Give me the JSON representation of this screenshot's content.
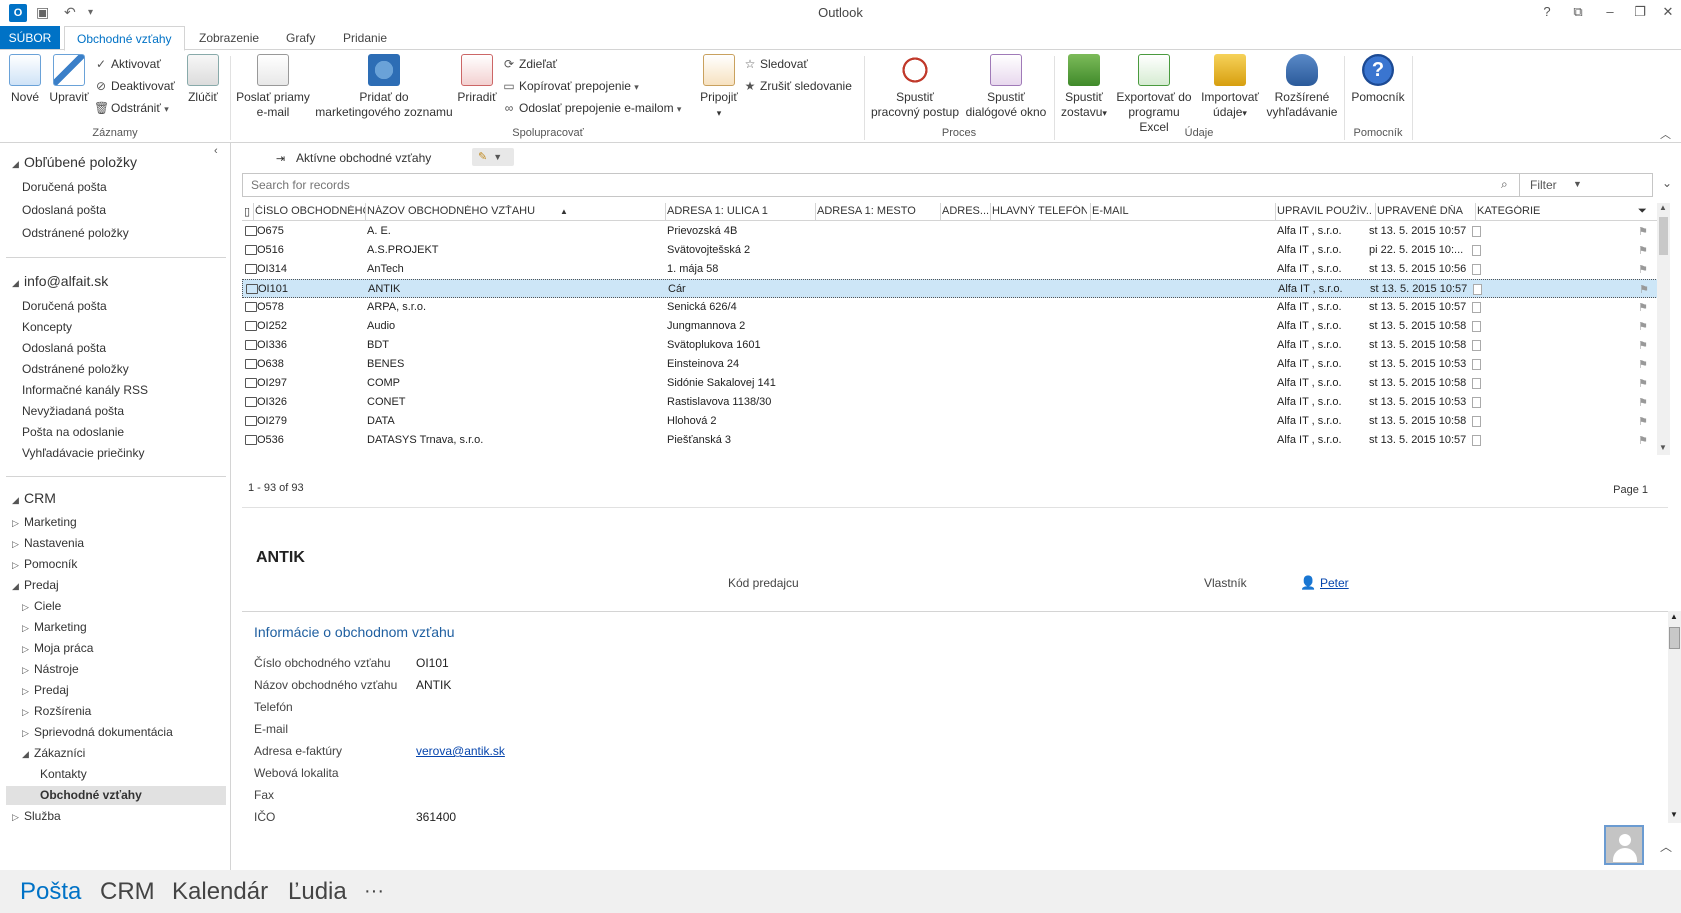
{
  "titlebar": {
    "app_title": "Outlook",
    "app_icon_letter": "O"
  },
  "tabs": [
    "SÚBOR",
    "Obchodné vzťahy",
    "Zobrazenie",
    "Grafy",
    "Pridanie"
  ],
  "ribbon": {
    "records": {
      "new": "Nové",
      "edit": "Upraviť",
      "activate": "Aktivovať",
      "deactivate": "Deaktivovať",
      "delete": "Odstrániť",
      "merge": "Zlúčiť",
      "label": "Záznamy"
    },
    "collaborate": {
      "send_email": "Poslať priamy e-mail",
      "send_email_l1": "Poslať priamy",
      "send_email_l2": "e-mail",
      "add_marketing_l1": "Pridať do",
      "add_marketing_l2": "marketingového zoznamu",
      "assign": "Priradiť",
      "share": "Zdieľať",
      "copy_link": "Kopírovať prepojenie",
      "email_link": "Odoslať prepojenie e-mailom",
      "connect": "Pripojiť",
      "follow": "Sledovať",
      "unfollow": "Zrušiť sledovanie",
      "label": "Spolupracovať"
    },
    "process": {
      "workflow_l1": "Spustiť",
      "workflow_l2": "pracovný postup",
      "dialog_l1": "Spustiť",
      "dialog_l2": "dialógové okno",
      "label": "Proces"
    },
    "data": {
      "report_l1": "Spustiť",
      "report_l2": "zostavu",
      "export_l1": "Exportovať do",
      "export_l2": "programu Excel",
      "import_l1": "Importovať",
      "import_l2": "údaje",
      "adv_l1": "Rozšírené",
      "adv_l2": "vyhľadávanie",
      "label": "Údaje"
    },
    "help": {
      "help": "Pomocník",
      "label": "Pomocník"
    }
  },
  "leftnav": {
    "favorites": {
      "title": "Obľúbené položky",
      "items": [
        "Doručená pošta",
        "Odoslaná pošta",
        "Odstránené položky"
      ]
    },
    "account": {
      "title": "info@alfait.sk",
      "items": [
        "Doručená pošta",
        "Koncepty",
        "Odoslaná pošta",
        "Odstránené položky",
        "Informačné kanály RSS",
        "Nevyžiadaná pošta",
        "Pošta na odoslanie",
        "Vyhľadávacie priečinky"
      ]
    },
    "crm": {
      "title": "CRM",
      "marketing": "Marketing",
      "settings": "Nastavenia",
      "help": "Pomocník",
      "sales": "Predaj",
      "sales_children": [
        "Ciele",
        "Marketing",
        "Moja práca",
        "Nástroje",
        "Predaj",
        "Rozšírenia",
        "Sprievodná dokumentácia"
      ],
      "customers": "Zákazníci",
      "contacts": "Kontakty",
      "accounts": "Obchodné vzťahy",
      "service": "Služba"
    }
  },
  "view": {
    "name": "Aktívne obchodné vzťahy"
  },
  "search": {
    "placeholder": "Search for records",
    "filter": "Filter"
  },
  "grid": {
    "columns": [
      "ČÍSLO OBCHODNÉHO...",
      "NÁZOV OBCHODNÉHO VZŤAHU",
      "ADRESA 1: ULICA 1",
      "ADRESA 1: MESTO",
      "ADRES...",
      "HLAVNÝ TELEFÓN",
      "E-MAIL",
      "UPRAVIL POUŽÍV...",
      "UPRAVENÉ DŇA",
      "KATEGÓRIE"
    ],
    "rows": [
      {
        "num": "O675",
        "name": "A. E.",
        "street": "Prievozská 4B",
        "modby": "Alfa IT , s.r.o.",
        "mod": "st 13. 5. 2015 10:57"
      },
      {
        "num": "O516",
        "name": "A.S.PROJEKT",
        "street": "Svätovojtešská 2",
        "modby": "Alfa IT , s.r.o.",
        "mod": "pi 22. 5. 2015 10:..."
      },
      {
        "num": "OI314",
        "name": "AnTech",
        "street": "1. mája 58",
        "modby": "Alfa IT , s.r.o.",
        "mod": "st 13. 5. 2015 10:56"
      },
      {
        "num": "OI101",
        "name": "ANTIK",
        "street": "Cár",
        "modby": "Alfa IT , s.r.o.",
        "mod": "st 13. 5. 2015 10:57"
      },
      {
        "num": "O578",
        "name": "ARPA, s.r.o.",
        "street": "Senická 626/4",
        "modby": "Alfa IT , s.r.o.",
        "mod": "st 13. 5. 2015 10:57"
      },
      {
        "num": "OI252",
        "name": "Audio",
        "street": "Jungmannova 2",
        "modby": "Alfa IT , s.r.o.",
        "mod": "st 13. 5. 2015 10:58"
      },
      {
        "num": "OI336",
        "name": "BDT",
        "street": "Svätoplukova 1601",
        "modby": "Alfa IT , s.r.o.",
        "mod": "st 13. 5. 2015 10:58"
      },
      {
        "num": "O638",
        "name": "BENES",
        "street": "Einsteinova 24",
        "modby": "Alfa IT , s.r.o.",
        "mod": "st 13. 5. 2015 10:53"
      },
      {
        "num": "OI297",
        "name": "COMP",
        "street": "Sidónie Sakalovej 141",
        "modby": "Alfa IT , s.r.o.",
        "mod": "st 13. 5. 2015 10:58"
      },
      {
        "num": "OI326",
        "name": "CONET",
        "street": "Rastislavova 1138/30",
        "modby": "Alfa IT , s.r.o.",
        "mod": "st 13. 5. 2015 10:53"
      },
      {
        "num": "OI279",
        "name": "DATA",
        "street": "Hlohová 2",
        "modby": "Alfa IT , s.r.o.",
        "mod": "st 13. 5. 2015 10:58"
      },
      {
        "num": "O536",
        "name": "DATASYS Trnava, s.r.o.",
        "street": "Piešťanská 3",
        "modby": "Alfa IT , s.r.o.",
        "mod": "st 13. 5. 2015 10:57"
      }
    ],
    "selected_index": 3
  },
  "pager": {
    "count": "1 - 93 of 93",
    "page": "Page 1"
  },
  "form": {
    "title": "ANTIK",
    "sales_code_label": "Kód predajcu",
    "owner_label": "Vlastník",
    "owner": "Peter",
    "section": "Informácie o obchodnom vzťahu",
    "fields": [
      {
        "label": "Číslo obchodného vzťahu",
        "value": "OI101"
      },
      {
        "label": "Názov obchodného vzťahu",
        "value": "ANTIK"
      },
      {
        "label": "Telefón",
        "value": ""
      },
      {
        "label": "E-mail",
        "value": ""
      },
      {
        "label": "Adresa e-faktúry",
        "value": "verova@antik.sk"
      },
      {
        "label": "Webová lokalita",
        "value": ""
      },
      {
        "label": "Fax",
        "value": ""
      },
      {
        "label": "IČO",
        "value": "361400"
      }
    ]
  },
  "bottomnav": [
    "Pošta",
    "CRM",
    "Kalendár",
    "Ľudia",
    "···"
  ],
  "colors": {
    "accent": "#0072c6",
    "selected_row": "#cde6f7",
    "section_title": "#1f5fa0"
  }
}
